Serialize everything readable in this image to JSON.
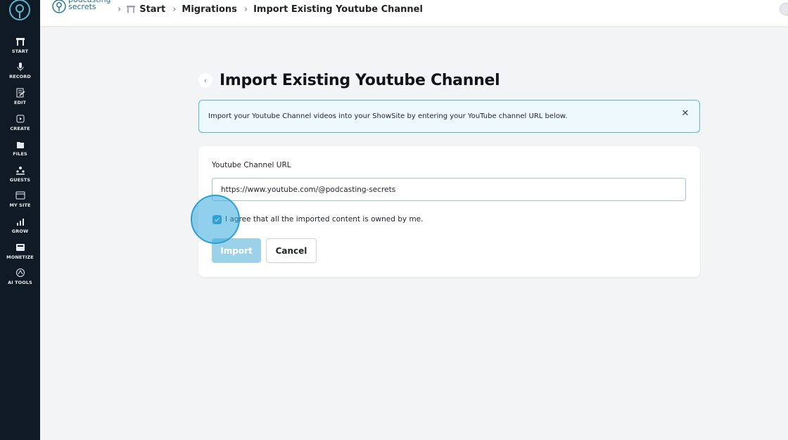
{
  "sidebar": {
    "items": [
      {
        "label": "START",
        "icon": "start-icon"
      },
      {
        "label": "RECORD",
        "icon": "microphone-icon"
      },
      {
        "label": "EDIT",
        "icon": "edit-icon"
      },
      {
        "label": "CREATE",
        "icon": "create-icon"
      },
      {
        "label": "FILES",
        "icon": "files-icon"
      },
      {
        "label": "GUESTS",
        "icon": "guests-icon"
      },
      {
        "label": "MY SITE",
        "icon": "my-site-icon"
      },
      {
        "label": "GROW",
        "icon": "grow-icon"
      },
      {
        "label": "MONETIZE",
        "icon": "monetize-icon"
      },
      {
        "label": "AI TOOLS",
        "icon": "ai-tools-icon"
      }
    ]
  },
  "header": {
    "brand_line1": "podcasting",
    "brand_line2": "secrets",
    "breadcrumb": [
      "Start",
      "Migrations",
      "Import Existing Youtube Channel"
    ]
  },
  "page": {
    "title": "Import Existing Youtube Channel",
    "banner_text": "Import your Youtube Channel videos into your ShowSite by entering your YouTube channel URL below.",
    "banner_close": "✕"
  },
  "form": {
    "url_label": "Youtube Channel URL",
    "url_value": "https://www.youtube.com/@podcasting-secrets",
    "agree_label": "I agree that all the imported content is owned by me.",
    "agree_checked": true,
    "import_label": "Import",
    "cancel_label": "Cancel"
  },
  "colors": {
    "sidebar_bg": "#0f1a24",
    "accent": "#2a95c6",
    "import_disabled": "#9bd2ea",
    "banner_border": "#5fb6cf"
  }
}
